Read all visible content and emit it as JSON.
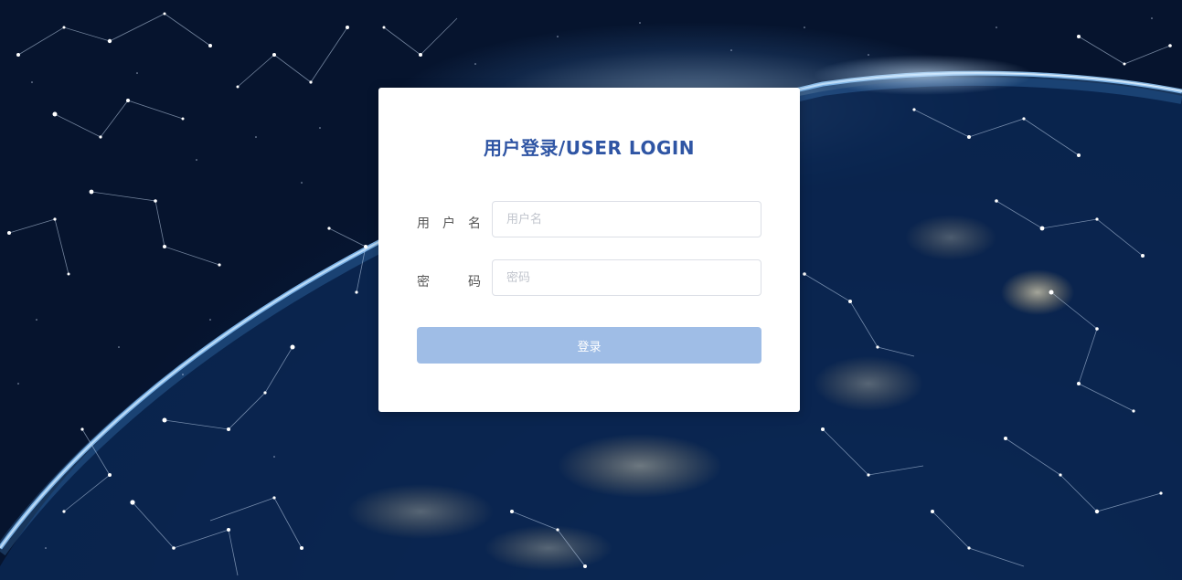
{
  "login": {
    "title": "用户登录/USER LOGIN",
    "username": {
      "label_chars": [
        "用",
        "户",
        "名"
      ],
      "placeholder": "用户名",
      "value": ""
    },
    "password": {
      "label_chars": [
        "密",
        "码"
      ],
      "placeholder": "密码",
      "value": ""
    },
    "submit_label": "登录"
  },
  "colors": {
    "title": "#2f55a4",
    "button_disabled": "#9fbde6",
    "background": "#0a2046"
  }
}
